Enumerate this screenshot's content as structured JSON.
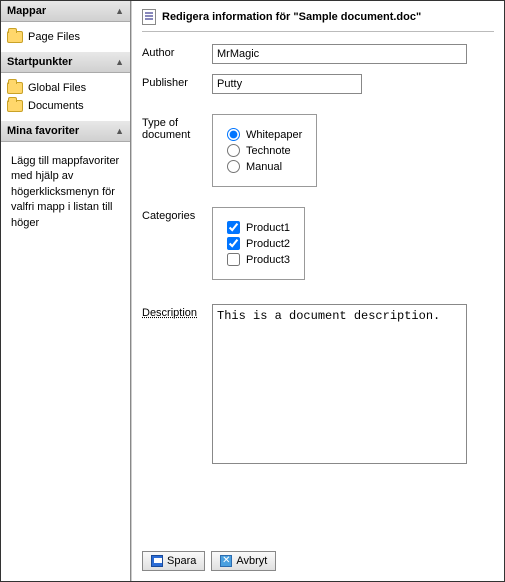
{
  "sidebar": {
    "panels": [
      {
        "title": "Mappar",
        "items": [
          {
            "label": "Page Files"
          }
        ]
      },
      {
        "title": "Startpunkter",
        "items": [
          {
            "label": "Global Files"
          },
          {
            "label": "Documents"
          }
        ]
      },
      {
        "title": "Mina favoriter",
        "text": "Lägg till mappfavoriter med hjälp av högerklicksmenyn för valfri mapp i listan till höger"
      }
    ]
  },
  "header": {
    "title": "Redigera information för \"Sample document.doc\""
  },
  "form": {
    "author": {
      "label": "Author",
      "value": "MrMagic"
    },
    "publisher": {
      "label": "Publisher",
      "value": "Putty"
    },
    "type": {
      "label": "Type of document",
      "options": [
        {
          "label": "Whitepaper",
          "checked": true
        },
        {
          "label": "Technote",
          "checked": false
        },
        {
          "label": "Manual",
          "checked": false
        }
      ]
    },
    "categories": {
      "label": "Categories",
      "options": [
        {
          "label": "Product1",
          "checked": true
        },
        {
          "label": "Product2",
          "checked": true
        },
        {
          "label": "Product3",
          "checked": false
        }
      ]
    },
    "description": {
      "label": "Description",
      "value": "This is a document description."
    }
  },
  "buttons": {
    "save": "Spara",
    "cancel": "Avbryt"
  }
}
